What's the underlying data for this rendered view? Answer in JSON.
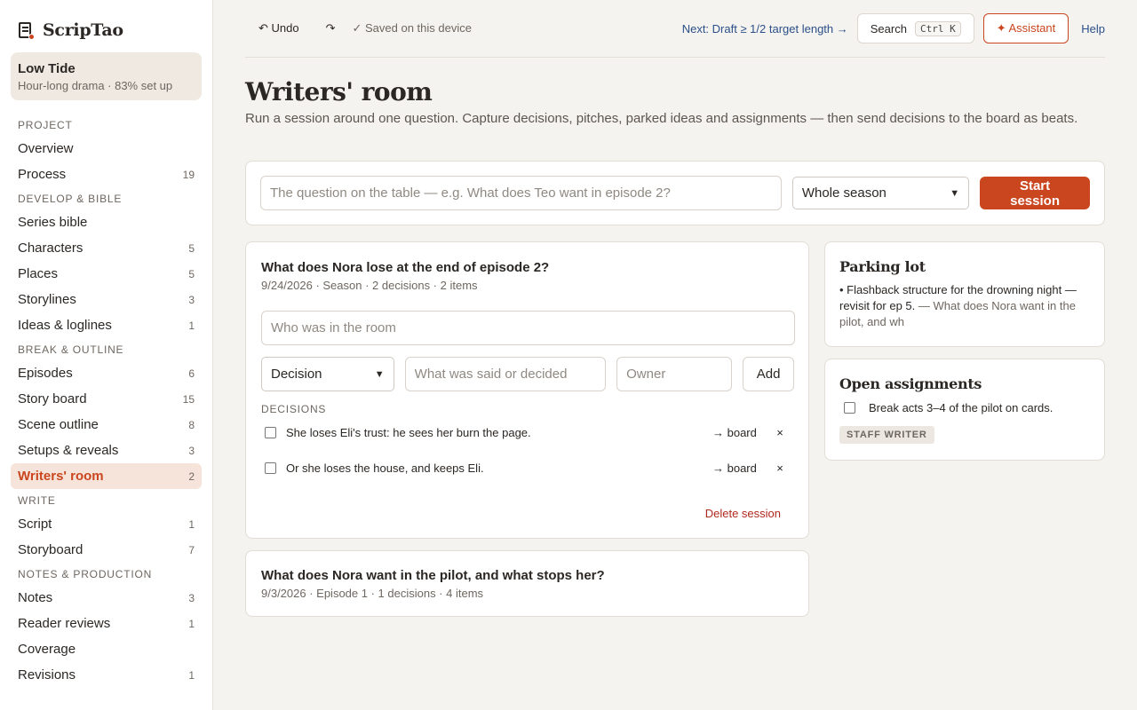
{
  "brand": {
    "name": "ScripTao"
  },
  "project": {
    "name": "Low Tide",
    "subtitle": "Hour-long drama · 83% set up"
  },
  "sidebar": {
    "sections": [
      {
        "label": "PROJECT",
        "items": [
          {
            "label": "Overview",
            "count": ""
          },
          {
            "label": "Process",
            "count": "19"
          }
        ]
      },
      {
        "label": "DEVELOP & BIBLE",
        "items": [
          {
            "label": "Series bible",
            "count": ""
          },
          {
            "label": "Characters",
            "count": "5"
          },
          {
            "label": "Places",
            "count": "5"
          },
          {
            "label": "Storylines",
            "count": "3"
          },
          {
            "label": "Ideas & loglines",
            "count": "1"
          }
        ]
      },
      {
        "label": "BREAK & OUTLINE",
        "items": [
          {
            "label": "Episodes",
            "count": "6"
          },
          {
            "label": "Story board",
            "count": "15"
          },
          {
            "label": "Scene outline",
            "count": "8"
          },
          {
            "label": "Setups & reveals",
            "count": "3"
          },
          {
            "label": "Writers' room",
            "count": "2"
          }
        ]
      },
      {
        "label": "WRITE",
        "items": [
          {
            "label": "Script",
            "count": "1"
          },
          {
            "label": "Storyboard",
            "count": "7"
          }
        ]
      },
      {
        "label": "NOTES & PRODUCTION",
        "items": [
          {
            "label": "Notes",
            "count": "3"
          },
          {
            "label": "Reader reviews",
            "count": "1"
          },
          {
            "label": "Coverage",
            "count": ""
          },
          {
            "label": "Revisions",
            "count": "1"
          }
        ]
      }
    ]
  },
  "topbar": {
    "undo": "↶ Undo",
    "redo": "↷",
    "saved": "✓ Saved on this device",
    "next": "Next: Draft ≥ 1/2 target length →",
    "search": "Search",
    "search_kbd": "Ctrl K",
    "assistant": "✦ Assistant",
    "help": "Help"
  },
  "page": {
    "title": "Writers' room",
    "description": "Run a session around one question. Capture decisions, pitches, parked ideas and assignments — then send decisions to the board as beats."
  },
  "session_bar": {
    "question_placeholder": "The question on the table — e.g. What does Teo want in episode 2?",
    "scope_selected": "Whole season",
    "start_label": "Start session"
  },
  "active_session": {
    "title": "What does Nora lose at the end of episode 2?",
    "meta": "9/24/2026 · Season · 2 decisions · 2 items",
    "room_placeholder": "Who was in the room",
    "type_selected": "Decision",
    "said_placeholder": "What was said or decided",
    "owner_placeholder": "Owner",
    "add_label": "Add",
    "decisions_label": "DECISIONS",
    "decisions": [
      {
        "text": "She loses Eli's trust: he sees her burn the page.",
        "board": "→ board",
        "remove": "×"
      },
      {
        "text": "Or she loses the house, and keeps Eli.",
        "board": "→ board",
        "remove": "×"
      }
    ],
    "delete_label": "Delete session"
  },
  "other_session": {
    "title": "What does Nora want in the pilot, and what stops her?",
    "meta": "9/3/2026 · Episode 1 · 1 decisions · 4 items"
  },
  "parking_lot": {
    "title": "Parking lot",
    "item_text": "• Flashback structure for the drowning night — revisit for ep 5.",
    "item_from": "— What does Nora want in the pilot, and wh"
  },
  "assignments": {
    "title": "Open assignments",
    "item_text": "Break acts 3–4 of the pilot on cards.",
    "owner_tag": "STAFF WRITER"
  }
}
